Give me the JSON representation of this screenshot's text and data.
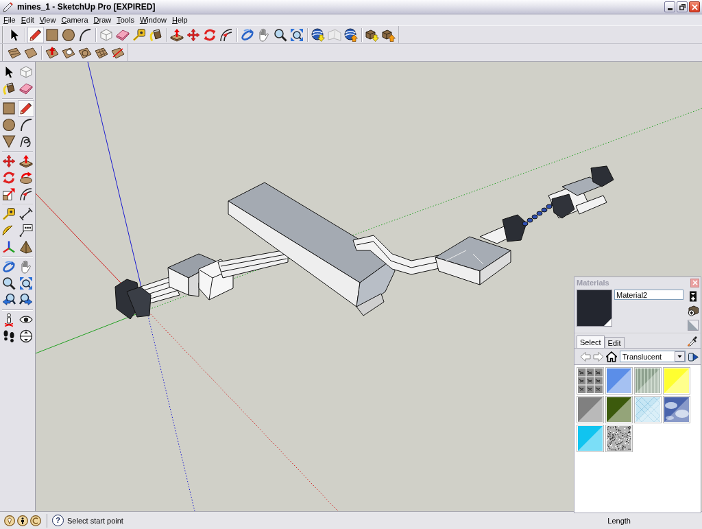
{
  "window": {
    "title": "mines_1 - SketchUp Pro [EXPIRED]"
  },
  "menu_bar": [
    "File",
    "Edit",
    "View",
    "Camera",
    "Draw",
    "Tools",
    "Window",
    "Help"
  ],
  "toolbars": [
    {
      "groups": [
        {
          "tools": [
            {
              "kind": "select",
              "selected": false
            }
          ]
        },
        {
          "tools": [
            {
              "kind": "pencil",
              "selected": true
            },
            {
              "kind": "rectangle",
              "selected": false
            },
            {
              "kind": "circle",
              "selected": false
            },
            {
              "kind": "arc",
              "selected": false
            }
          ]
        },
        {
          "tools": [
            {
              "kind": "component",
              "selected": false
            },
            {
              "kind": "eraser",
              "selected": false
            },
            {
              "kind": "tape",
              "selected": false
            },
            {
              "kind": "paint",
              "selected": false
            }
          ]
        },
        {
          "tools": [
            {
              "kind": "pushpull",
              "selected": false
            },
            {
              "kind": "move",
              "selected": false
            },
            {
              "kind": "rotate",
              "selected": false
            },
            {
              "kind": "offset",
              "selected": false
            }
          ]
        },
        {
          "tools": [
            {
              "kind": "orbit",
              "selected": false
            },
            {
              "kind": "pan",
              "selected": false
            },
            {
              "kind": "zoom",
              "selected": false
            },
            {
              "kind": "extents",
              "selected": false
            }
          ]
        },
        {
          "tools": [
            {
              "kind": "globedown",
              "selected": false
            },
            {
              "kind": "terrain",
              "selected": false
            },
            {
              "kind": "globeup",
              "selected": false
            }
          ]
        },
        {
          "tools": [
            {
              "kind": "boxesdown",
              "selected": false
            },
            {
              "kind": "boxesup",
              "selected": false
            }
          ]
        }
      ]
    },
    {
      "groups": [
        {
          "tools": [
            {
              "kind": "contours",
              "selected": false
            },
            {
              "kind": "scratch",
              "selected": false
            }
          ]
        },
        {
          "tools": [
            {
              "kind": "smoove",
              "selected": false
            },
            {
              "kind": "stamp",
              "selected": false
            },
            {
              "kind": "drape",
              "selected": false
            },
            {
              "kind": "detail",
              "selected": false
            },
            {
              "kind": "flip",
              "selected": false
            }
          ]
        }
      ]
    }
  ],
  "tool_palette": {
    "groups": [
      {
        "tools": [
          {
            "kind": "select",
            "selected": false
          },
          {
            "kind": "component",
            "selected": false
          },
          {
            "kind": "paint",
            "selected": false
          },
          {
            "kind": "eraser",
            "selected": false
          }
        ]
      },
      {
        "tools": [
          {
            "kind": "rectangle",
            "selected": false
          },
          {
            "kind": "pencil",
            "selected": true
          },
          {
            "kind": "circle",
            "selected": false
          },
          {
            "kind": "arc",
            "selected": false
          },
          {
            "kind": "polygon",
            "selected": false
          },
          {
            "kind": "freehand",
            "selected": false
          }
        ]
      },
      {
        "tools": [
          {
            "kind": "move",
            "selected": false
          },
          {
            "kind": "pushpull",
            "selected": false
          },
          {
            "kind": "rotate",
            "selected": false
          },
          {
            "kind": "followme",
            "selected": false
          },
          {
            "kind": "scale",
            "selected": false
          },
          {
            "kind": "offset",
            "selected": false
          }
        ]
      },
      {
        "tools": [
          {
            "kind": "tape",
            "selected": false
          },
          {
            "kind": "dimension",
            "selected": false
          },
          {
            "kind": "protractor",
            "selected": false
          },
          {
            "kind": "text",
            "selected": false
          },
          {
            "kind": "axes",
            "selected": false
          },
          {
            "kind": "text3d",
            "selected": false
          }
        ]
      },
      {
        "tools": [
          {
            "kind": "orbit",
            "selected": false
          },
          {
            "kind": "pan",
            "selected": false
          },
          {
            "kind": "zoom",
            "selected": false
          },
          {
            "kind": "extents",
            "selected": false
          },
          {
            "kind": "previous",
            "selected": false
          },
          {
            "kind": "next",
            "selected": false
          }
        ]
      },
      {
        "tools": [
          {
            "kind": "position",
            "selected": false
          },
          {
            "kind": "lookaround",
            "selected": false
          },
          {
            "kind": "walk",
            "selected": false
          },
          {
            "kind": "section",
            "selected": false
          }
        ]
      }
    ]
  },
  "materials_panel": {
    "title": "Materials",
    "material_name": "Material2",
    "tabs": [
      {
        "label": "Select",
        "selected": true
      },
      {
        "label": "Edit",
        "selected": false
      }
    ],
    "library": "Translucent",
    "swatches": [
      {
        "kind": "tiles",
        "color": "#8c8c8c"
      },
      {
        "kind": "plain",
        "color": "#5b8ee8"
      },
      {
        "kind": "stripes",
        "color": "#8da08e"
      },
      {
        "kind": "plain",
        "color": "#ffff30"
      },
      {
        "kind": "plain",
        "color": "#808080"
      },
      {
        "kind": "plain",
        "color": "#3c5a0c"
      },
      {
        "kind": "grid",
        "color": "#c6e6f4"
      },
      {
        "kind": "clouds",
        "color": "#4a64ac"
      },
      {
        "kind": "plain",
        "color": "#10c4f0"
      },
      {
        "kind": "speckle",
        "color": "#b4b4b4"
      }
    ]
  },
  "status_bar": {
    "help_symbol": "?",
    "hint": "Select start point",
    "measurement_label": "Length"
  }
}
